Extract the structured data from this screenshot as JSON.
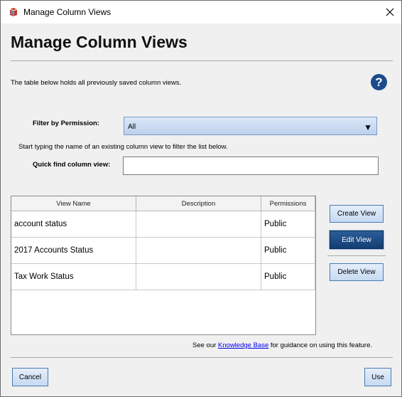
{
  "window": {
    "title": "Manage Column Views"
  },
  "header": {
    "heading": "Manage Column Views"
  },
  "intro": "The table below holds all previously saved column views.",
  "filter": {
    "label": "Filter by Permission:",
    "value": "All"
  },
  "quick_find": {
    "hint": "Start typing the name of an existing column view to filter the list below.",
    "label": "Quick find column view:",
    "value": ""
  },
  "table": {
    "columns": [
      "View Name",
      "Description",
      "Permissions"
    ],
    "rows": [
      {
        "name": "account status",
        "description": "",
        "permission": "Public"
      },
      {
        "name": "2017 Accounts Status",
        "description": "",
        "permission": "Public"
      },
      {
        "name": "Tax Work Status",
        "description": "",
        "permission": "Public"
      }
    ]
  },
  "actions": {
    "create": "Create View",
    "edit": "Edit View",
    "delete": "Delete View"
  },
  "footer": {
    "prefix": "See our",
    "link": "Knowledge Base",
    "suffix": "for guidance on using this feature."
  },
  "buttons": {
    "cancel": "Cancel",
    "use": "Use"
  },
  "colors": {
    "accent": "#1c4b8c",
    "primary_button": "#143e72",
    "link": "#0000ee"
  }
}
